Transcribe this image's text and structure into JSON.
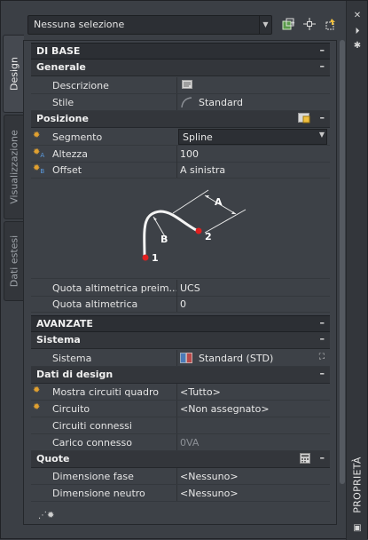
{
  "tabs": [
    {
      "label": "Design"
    },
    {
      "label": "Visualizzazione"
    },
    {
      "label": "Dati estesi"
    }
  ],
  "toolbar": {
    "selection": "Nessuna selezione"
  },
  "rail": {
    "title": "PROPRIETÀ"
  },
  "sections": {
    "base": {
      "title": "DI BASE",
      "generale": {
        "title": "Generale",
        "rows": [
          {
            "label": "Descrizione",
            "value": ""
          },
          {
            "label": "Stile",
            "value": "Standard"
          }
        ]
      },
      "posizione": {
        "title": "Posizione",
        "rows": [
          {
            "label": "Segmento",
            "value": "Spline"
          },
          {
            "label": "Altezza",
            "value": "100"
          },
          {
            "label": "Offset",
            "value": "A sinistra"
          },
          {
            "label": "Quota altimetrica preim...",
            "value": "UCS"
          },
          {
            "label": "Quota altimetrica",
            "value": "0"
          }
        ],
        "diagram": {
          "labels": [
            "A",
            "B",
            "1",
            "2"
          ]
        }
      }
    },
    "avanzate": {
      "title": "AVANZATE",
      "sistema": {
        "title": "Sistema",
        "rows": [
          {
            "label": "Sistema",
            "value": "Standard (STD)"
          }
        ]
      },
      "design": {
        "title": "Dati di design",
        "rows": [
          {
            "label": "Mostra circuiti quadro",
            "value": "<Tutto>"
          },
          {
            "label": "Circuito",
            "value": "<Non assegnato>"
          },
          {
            "label": "Circuiti connessi",
            "value": ""
          },
          {
            "label": "Carico connesso",
            "value": "0VA"
          }
        ]
      },
      "quote": {
        "title": "Quote",
        "rows": [
          {
            "label": "Dimensione fase",
            "value": "<Nessuno>"
          },
          {
            "label": "Dimensione neutro",
            "value": "<Nessuno>"
          }
        ]
      }
    }
  },
  "collapse_glyph": "–"
}
